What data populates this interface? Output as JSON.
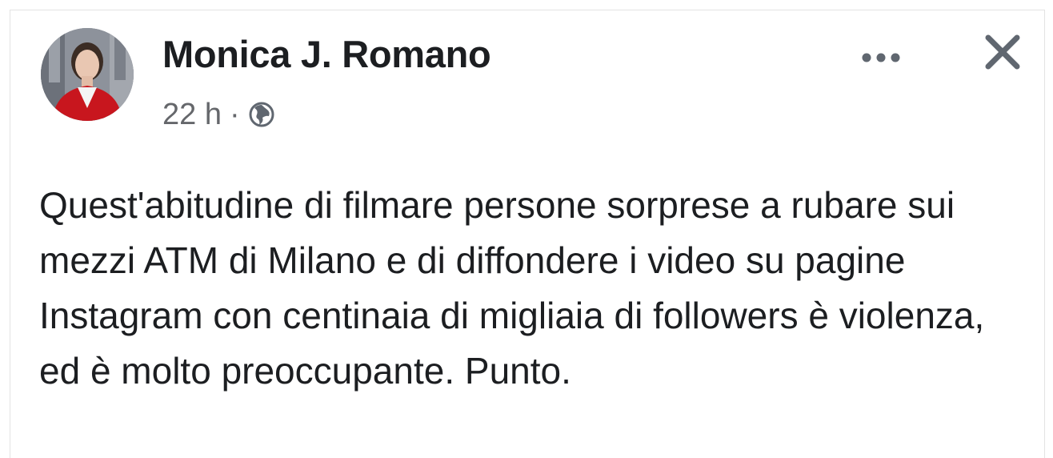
{
  "post": {
    "author": {
      "name": "Monica J. Romano",
      "avatar_icon": "profile-photo"
    },
    "meta": {
      "time": "22 h",
      "separator": "·",
      "audience_icon": "globe-icon"
    },
    "actions": {
      "more_icon": "more-icon",
      "close_icon": "close-icon"
    },
    "text": "Quest'abitudine di filmare persone sorprese a rubare sui mezzi ATM di Milano e di diffondere i video su pagine Instagram con centinaia di migliaia di followers è violenza, ed è molto preoccupante. Punto."
  },
  "colors": {
    "name_text": "#1c1e21",
    "meta_text": "#65676b",
    "icon_gray": "#606770",
    "jacket_red": "#c8161e"
  }
}
